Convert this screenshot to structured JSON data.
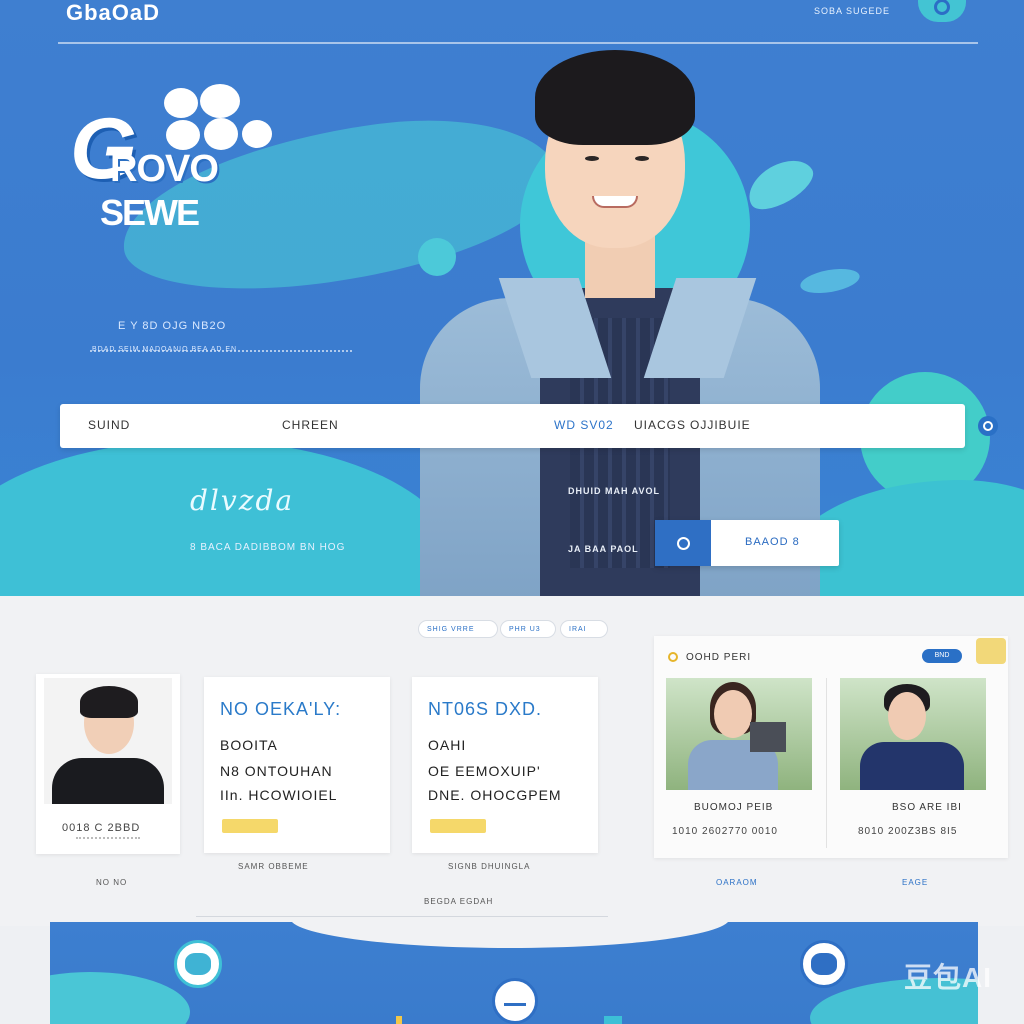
{
  "header": {
    "brand": "GbaOaD",
    "nav_text": "SOBA SUGEDE"
  },
  "hero": {
    "logo_letter": "G",
    "logo_word1": "ROVO",
    "logo_word2": "SEWE",
    "tagline": "E Y 8D   OJG NB2O",
    "subtagline": "BDAD SEIM MADOANIO BEA AD EN",
    "search": {
      "field1": "SUIND",
      "field2": "CHREEN",
      "field3": "WD SV02",
      "field4": "UIACGS",
      "field5": "OJJIBUIE"
    },
    "script_title": "dlvzda",
    "script_sub": "8 BACA DADIBBOM BN HOG",
    "shirt_text": "DHUID MAH AVOL",
    "shirt_text2": "JA BAA PAOL",
    "cta_label": "BAAOD 8"
  },
  "middle": {
    "pills": [
      "SHIG VRRE",
      "PHR U3",
      "IRAI"
    ],
    "profile": {
      "stat": "0018   C 2BBD",
      "below": "NO NO"
    },
    "card1": {
      "title": "NO OEKA'LY:",
      "line1": "BOOITA",
      "line2": "N8  ONTOUHAN",
      "line3": "IIn.  HCOWIOIEL",
      "below": "SAMR OBBEME"
    },
    "card2": {
      "title": "NT06S DXD.",
      "line1": "OAHI",
      "line2": "OE  EEMOXUIP'",
      "line3": "DNE.  OHOCGPEM",
      "below": "SIGNB DHUINGLA"
    },
    "feature": {
      "header": "OOHD PERI",
      "chip": "BND",
      "photo1_caption": "BUOMOJ PEIB",
      "photo1_meta": "1010    2602770   0010",
      "photo2_caption": "BSO ARE IBI",
      "photo2_meta": "8010   200Z3BS  8I5",
      "below1": "OARAOM",
      "below2": "EAGE"
    },
    "footer_text": "BEGDA EGDAH"
  },
  "watermark": "豆包AI"
}
